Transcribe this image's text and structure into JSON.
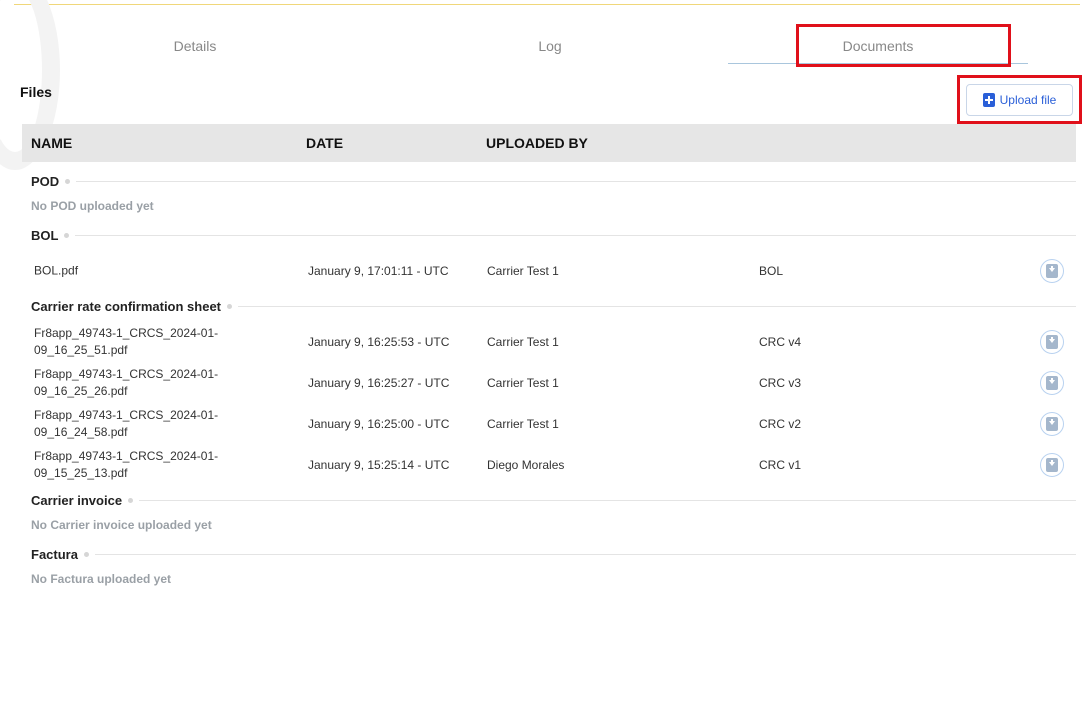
{
  "tabs": {
    "details": "Details",
    "log": "Log",
    "documents": "Documents"
  },
  "files_title": "Files",
  "upload_label": "Upload file",
  "table": {
    "headers": {
      "name": "NAME",
      "date": "DATE",
      "uploaded_by": "UPLOADED BY"
    }
  },
  "sections": {
    "pod": {
      "title": "POD",
      "empty": "No POD uploaded yet"
    },
    "bol": {
      "title": "BOL",
      "rows": [
        {
          "name": "BOL.pdf",
          "date": "January 9, 17:01:11 - UTC",
          "by": "Carrier Test 1",
          "tag": "BOL"
        }
      ]
    },
    "crcs": {
      "title": "Carrier rate confirmation sheet",
      "rows": [
        {
          "name": "Fr8app_49743-1_CRCS_2024-01-09_16_25_51.pdf",
          "date": "January 9, 16:25:53 - UTC",
          "by": "Carrier Test 1",
          "tag": "CRC v4"
        },
        {
          "name": "Fr8app_49743-1_CRCS_2024-01-09_16_25_26.pdf",
          "date": "January 9, 16:25:27 - UTC",
          "by": "Carrier Test 1",
          "tag": "CRC v3"
        },
        {
          "name": "Fr8app_49743-1_CRCS_2024-01-09_16_24_58.pdf",
          "date": "January 9, 16:25:00 - UTC",
          "by": "Carrier Test 1",
          "tag": "CRC v2"
        },
        {
          "name": "Fr8app_49743-1_CRCS_2024-01-09_15_25_13.pdf",
          "date": "January 9, 15:25:14 - UTC",
          "by": "Diego Morales",
          "tag": "CRC v1"
        }
      ]
    },
    "invoice": {
      "title": "Carrier invoice",
      "empty": "No Carrier invoice uploaded yet"
    },
    "factura": {
      "title": "Factura",
      "empty": "No Factura uploaded yet"
    }
  },
  "colors": {
    "accent": "#2a5fd8",
    "highlight": "#e0101a"
  }
}
